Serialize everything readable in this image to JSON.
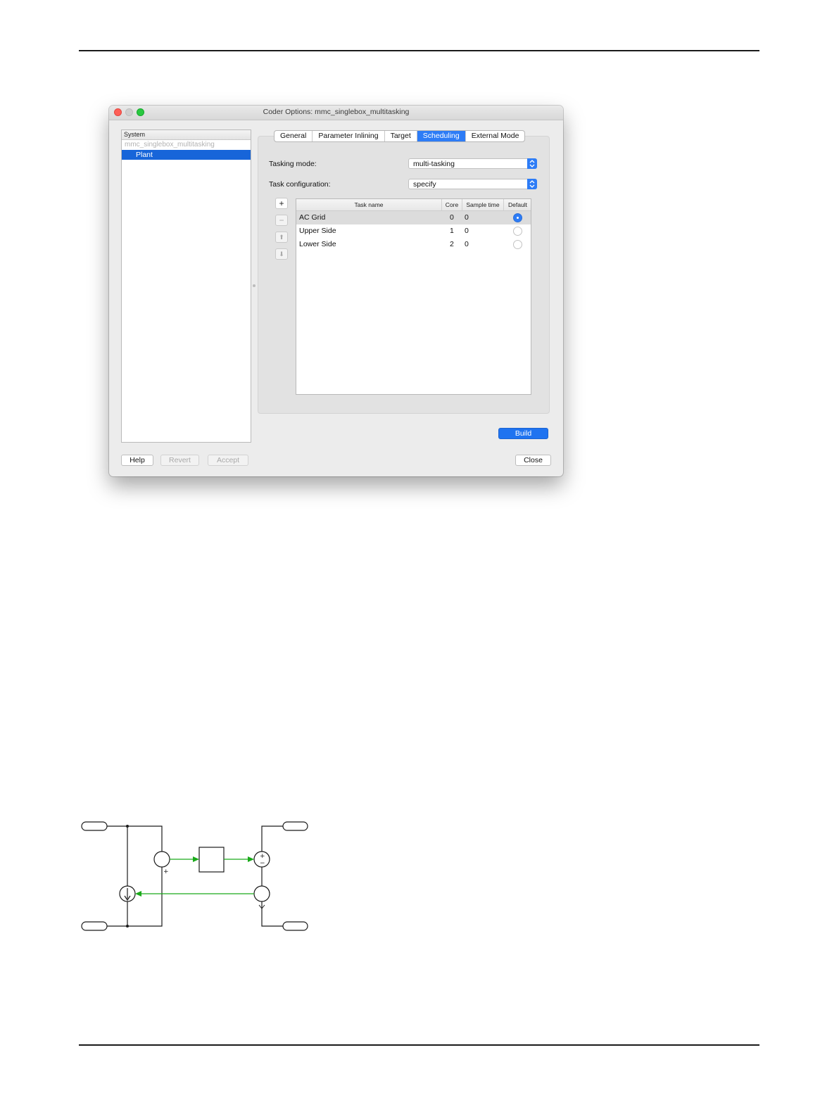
{
  "window": {
    "title": "Coder Options: mmc_singlebox_multitasking"
  },
  "tree": {
    "header": "System",
    "root": "mmc_singlebox_multitasking",
    "selected": "Plant"
  },
  "tabs": [
    {
      "label": "General",
      "active": false
    },
    {
      "label": "Parameter Inlining",
      "active": false
    },
    {
      "label": "Target",
      "active": false
    },
    {
      "label": "Scheduling",
      "active": true
    },
    {
      "label": "External Mode",
      "active": false
    }
  ],
  "scheduling": {
    "tasking_mode_label": "Tasking mode:",
    "tasking_mode_value": "multi-tasking",
    "task_config_label": "Task configuration:",
    "task_config_value": "specify",
    "side_buttons": {
      "add": "+",
      "remove": "−",
      "up": "⬆",
      "down": "⬇"
    },
    "table": {
      "columns": [
        "Task name",
        "Core",
        "Sample time",
        "Default"
      ],
      "rows": [
        {
          "name": "AC Grid",
          "core": "0",
          "sample_time": "0",
          "default": true
        },
        {
          "name": "Upper Side",
          "core": "1",
          "sample_time": "0",
          "default": false
        },
        {
          "name": "Lower Side",
          "core": "2",
          "sample_time": "0",
          "default": false
        }
      ]
    }
  },
  "buttons": {
    "build": "Build",
    "help": "Help",
    "revert": "Revert",
    "accept": "Accept",
    "close": "Close"
  },
  "schematic": {
    "plus_label": "+",
    "sum_plus": "+",
    "sum_minus": "−"
  },
  "colors": {
    "accent": "#2d7cf6",
    "selection": "#1765d9",
    "signal": "#1aaa1a"
  }
}
